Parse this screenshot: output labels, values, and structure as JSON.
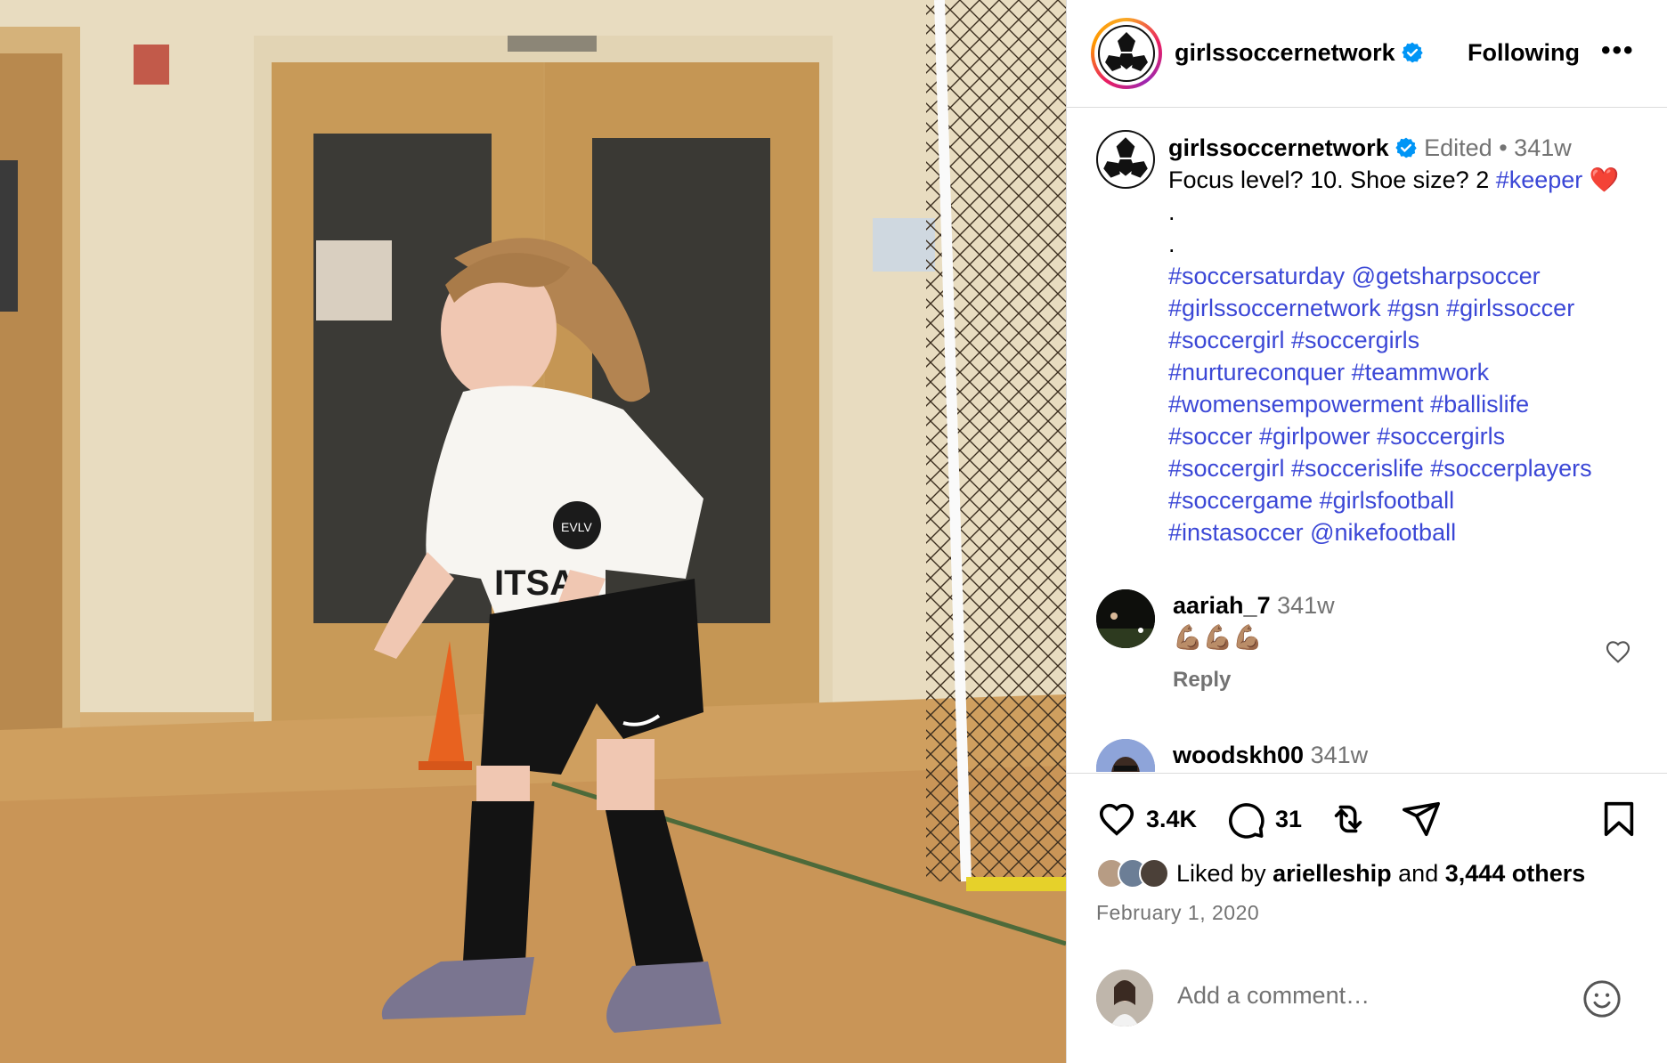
{
  "post": {
    "username": "girlssoccernetwork",
    "follow_label": "Following",
    "more_label": "•••",
    "image_alt": "Young girl in white EVLV shirt playing soccer keeper indoors"
  },
  "caption": {
    "username": "girlssoccernetwork",
    "edited": "Edited",
    "dot": "•",
    "age": "341w",
    "text_plain": "Focus level? 10. Shoe size? 2 ",
    "keeper_tag": "#keeper",
    "heart": "❤️",
    "dot_line1": ".",
    "dot_line2": ".",
    "lines": [
      "#soccersaturday @getsharpsoccer",
      "#girlssoccernetwork #gsn #girlssoccer",
      "#soccergirl #soccergirls",
      "#nurtureconquer #teammwork",
      "#womensempowerment #ballislife",
      "#soccer #girlpower #soccergirls",
      "#soccergirl #soccerislife #soccerplayers",
      "#soccergame #girlsfootball",
      "#instasoccer @nikefootball"
    ]
  },
  "comments": [
    {
      "username": "aariah_7",
      "age": "341w",
      "text": "💪🏽💪🏽💪🏽",
      "reply_label": "Reply"
    },
    {
      "username": "woodskh00",
      "age": "341w"
    }
  ],
  "actions": {
    "like_count": "3.4K",
    "comment_count": "31"
  },
  "likes": {
    "prefix": "Liked by ",
    "user": "arielleship",
    "middle": " and ",
    "others": "3,444 others"
  },
  "date": "February 1, 2020",
  "add_comment": {
    "placeholder": "Add a comment…"
  },
  "colors": {
    "hashtag": "#3b47d6",
    "verified": "#0095f6",
    "muted": "#737373"
  }
}
